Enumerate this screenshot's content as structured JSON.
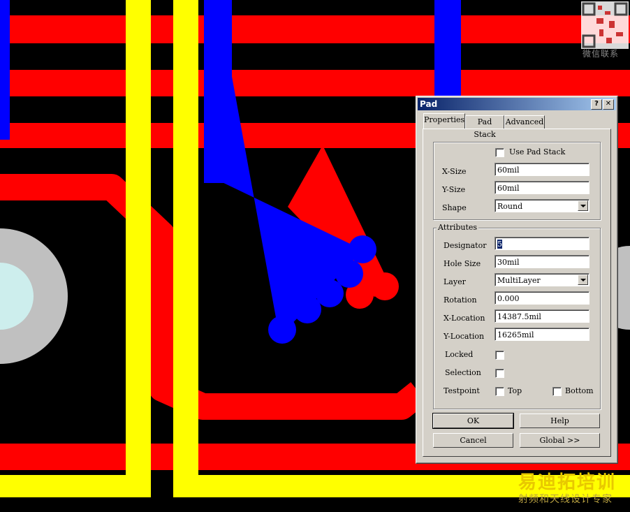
{
  "watermark": {
    "contact_text": "微信联系"
  },
  "brand": {
    "title": "易迪拓培训",
    "subtitle": "射频和天线设计专家"
  },
  "dialog": {
    "title": "Pad",
    "help_btn": "?",
    "close_btn": "✕",
    "tabs": [
      {
        "label": "Properties",
        "active": true
      },
      {
        "label": "Pad Stack",
        "active": false
      },
      {
        "label": "Advanced",
        "active": false
      }
    ],
    "size_group": {
      "use_pad_stack_label": "Use Pad Stack",
      "use_pad_stack_checked": false,
      "x_size_label": "X-Size",
      "x_size_value": "60mil",
      "y_size_label": "Y-Size",
      "y_size_value": "60mil",
      "shape_label": "Shape",
      "shape_value": "Round"
    },
    "attributes": {
      "group_title": "Attributes",
      "designator_label": "Designator",
      "designator_value": "5",
      "hole_size_label": "Hole Size",
      "hole_size_value": "30mil",
      "layer_label": "Layer",
      "layer_value": "MultiLayer",
      "rotation_label": "Rotation",
      "rotation_value": "0.000",
      "x_location_label": "X-Location",
      "x_location_value": "14387.5mil",
      "y_location_label": "Y-Location",
      "y_location_value": "16265mil",
      "locked_label": "Locked",
      "locked_checked": false,
      "selection_label": "Selection",
      "selection_checked": false,
      "testpoint_label": "Testpoint",
      "top_label": "Top",
      "top_checked": false,
      "bottom_label": "Bottom",
      "bottom_checked": false
    },
    "buttons": {
      "ok": "OK",
      "help": "Help",
      "cancel": "Cancel",
      "global": "Global >>"
    }
  },
  "colors": {
    "canvas": "#000000",
    "top_layer": "#ff0000",
    "bottom_layer": "#0000ff",
    "top_overlay": "#ffff00",
    "pad_ring": "#c0c0c0",
    "pad_hole": "#cdeeed"
  }
}
